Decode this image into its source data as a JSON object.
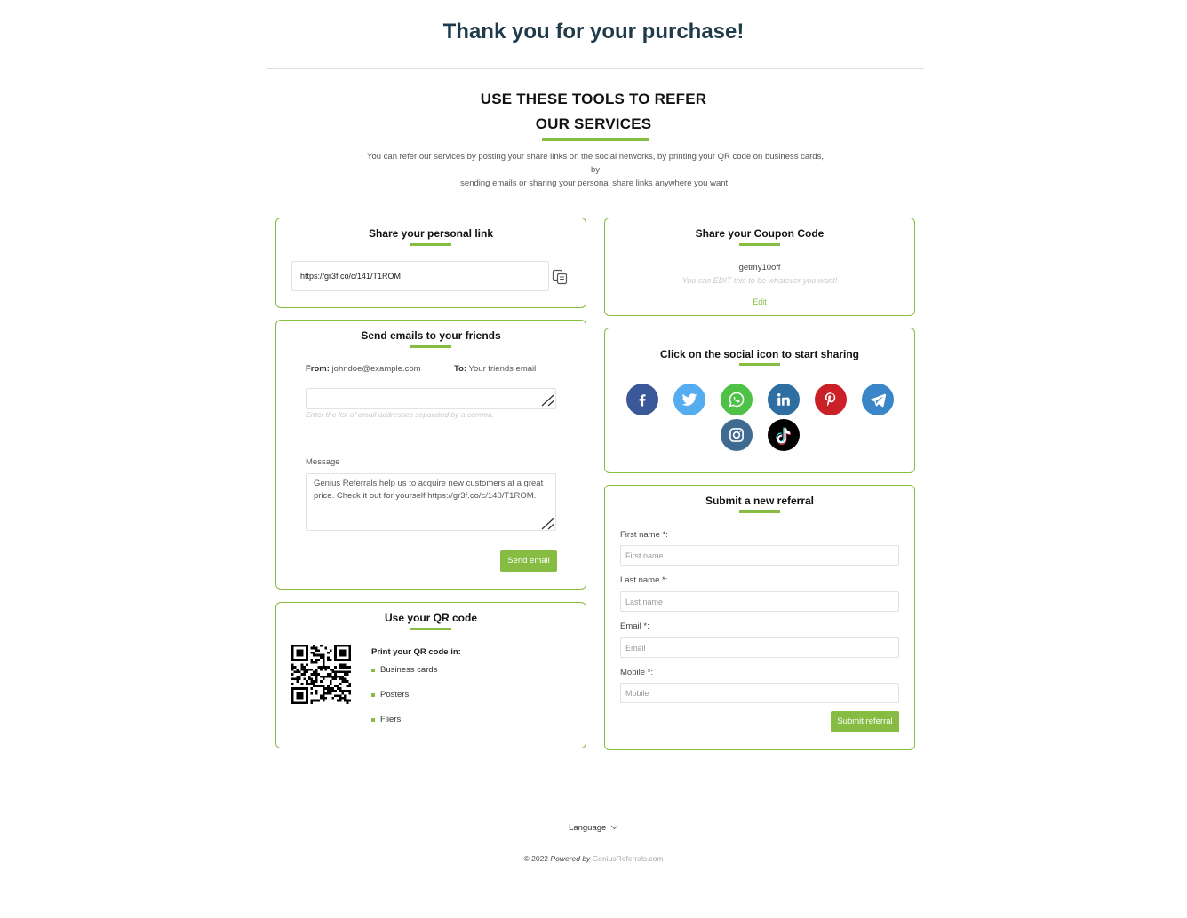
{
  "header": {
    "title": "Thank you for your purchase!"
  },
  "refer": {
    "heading_line1": "USE THESE TOOLS TO REFER",
    "heading_line2": "OUR SERVICES",
    "intro_line1": "You can refer our services by posting your share links on the social networks, by printing your QR code on business cards, by",
    "intro_line2": "sending emails or sharing your personal share links anywhere you want."
  },
  "personal_link": {
    "title": "Share your personal link",
    "url": "https://gr3f.co/c/141/T1ROM",
    "copy_icon": "copy-icon"
  },
  "coupon": {
    "title": "Share your Coupon Code",
    "code": "getmy10off",
    "hint": "You can EDIT this to be whatever you want!",
    "edit_label": "Edit"
  },
  "emails": {
    "title": "Send emails to your friends",
    "from_label": "From:",
    "from_value": "johndoe@example.com",
    "to_label": "To:",
    "to_value": "Your friends email",
    "to_hint": "Enter the list of email addresses separated by a comma.",
    "message_label": "Message",
    "message_value": "Genius Referrals help us to acquire new customers at a great price. Check it out for yourself https://gr3f.co/c/140/T1ROM.",
    "send_label": "Send email"
  },
  "social": {
    "title": "Click on the social icon to start sharing",
    "networks": [
      {
        "name": "facebook",
        "color": "#3b5998"
      },
      {
        "name": "twitter",
        "color": "#55acee"
      },
      {
        "name": "whatsapp",
        "color": "#4dc247"
      },
      {
        "name": "linkedin",
        "color": "#2f6ea3"
      },
      {
        "name": "pinterest",
        "color": "#cb2027"
      },
      {
        "name": "telegram",
        "color": "#3a86c8"
      },
      {
        "name": "instagram",
        "color": "#3f6b91"
      },
      {
        "name": "tiktok",
        "color": "#000000"
      }
    ]
  },
  "qr": {
    "title": "Use your QR code",
    "heading": "Print your QR code in:",
    "uses": [
      "Business cards",
      "Posters",
      "Fliers"
    ]
  },
  "referral_form": {
    "title": "Submit a new referral",
    "fields": [
      {
        "label": "First name *:",
        "placeholder": "First name"
      },
      {
        "label": "Last name *:",
        "placeholder": "Last name"
      },
      {
        "label": "Email *:",
        "placeholder": "Email"
      },
      {
        "label": "Mobile *:",
        "placeholder": "Mobile"
      }
    ],
    "submit_label": "Submit referral"
  },
  "footer": {
    "language_label": "Language",
    "copyright": "© 2022",
    "powered_by": "Powered by",
    "brand": "GeniusReferrals.com"
  },
  "colors": {
    "accent": "#86bc42",
    "title": "#1f3b4a",
    "border": "#86bc42"
  }
}
